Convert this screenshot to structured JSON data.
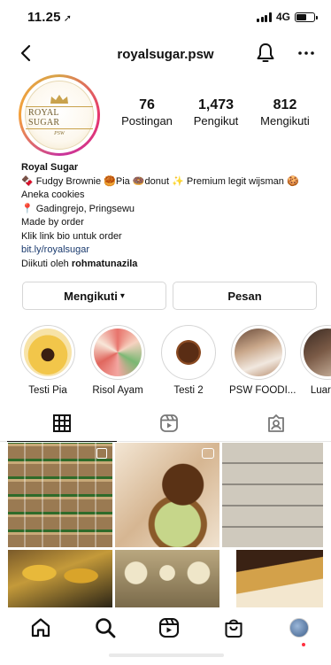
{
  "status_bar": {
    "time": "11.25",
    "network": "4G"
  },
  "nav": {
    "username": "royalsugar.psw"
  },
  "profile": {
    "logo_text": "ROYAL SUGAR",
    "logo_sub": "PSW",
    "stats": [
      {
        "num": "76",
        "label": "Postingan"
      },
      {
        "num": "1,473",
        "label": "Pengikut"
      },
      {
        "num": "812",
        "label": "Mengikuti"
      }
    ]
  },
  "bio": {
    "name": "Royal Sugar",
    "line1": "🍫 Fudgy Brownie 🥮Pia 🍩donut ✨ Premium legit wijsman 🍪Aneka cookies",
    "line2": "📍 Gadingrejo, Pringsewu",
    "line3": "Made by order",
    "line4": "Klik link bio untuk order",
    "link": "bit.ly/royalsugar",
    "followed_prefix": "Diikuti oleh ",
    "followed_user": "rohmatunazila"
  },
  "buttons": {
    "following": "Mengikuti",
    "message": "Pesan"
  },
  "highlights": [
    {
      "label": "Testi Pia"
    },
    {
      "label": "Risol Ayam"
    },
    {
      "label": "Testi 2"
    },
    {
      "label": "PSW FOODI..."
    },
    {
      "label": "Luar ko"
    }
  ],
  "colors": {
    "link": "#1a3a6e",
    "border": "#d6d6d6",
    "notification_dot": "#ff3040"
  },
  "icons": {
    "back": "chevron-left-icon",
    "bell": "bell-icon",
    "more": "more-icon",
    "grid": "grid-icon",
    "reels": "reels-icon",
    "tagged": "tagged-icon",
    "home": "home-icon",
    "search": "search-icon",
    "shop": "shop-icon"
  }
}
